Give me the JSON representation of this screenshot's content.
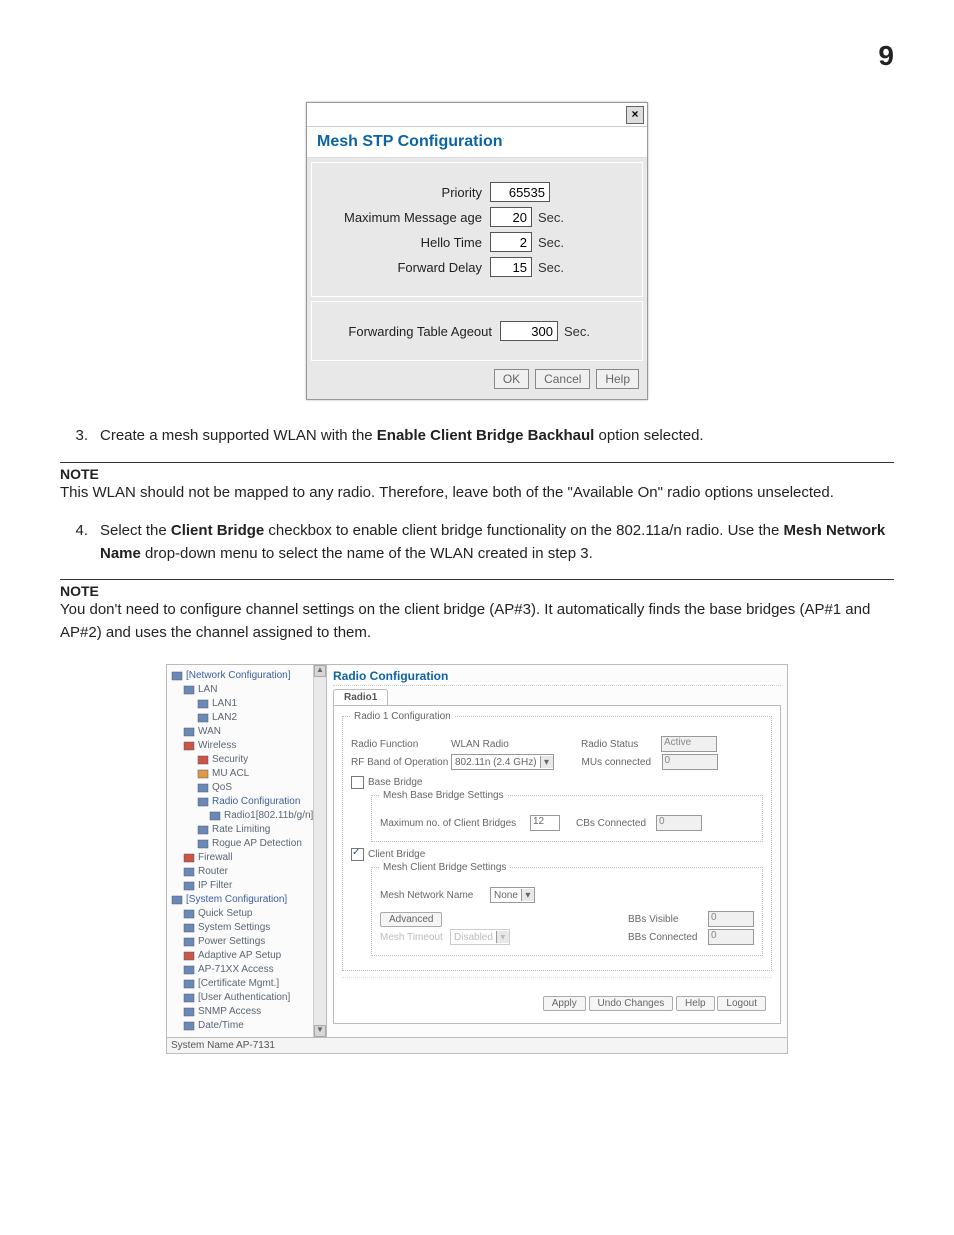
{
  "page_number": "9",
  "dialog": {
    "title": "Mesh STP Configuration",
    "close_label": "×",
    "rows": [
      {
        "label": "Priority",
        "value": "65535",
        "unit": "",
        "narrow": false
      },
      {
        "label": "Maximum Message age",
        "value": "20",
        "unit": "Sec.",
        "narrow": true
      },
      {
        "label": "Hello Time",
        "value": "2",
        "unit": "Sec.",
        "narrow": true
      },
      {
        "label": "Forward Delay",
        "value": "15",
        "unit": "Sec.",
        "narrow": true
      }
    ],
    "ageout_label": "Forwarding Table Ageout",
    "ageout_value": "300",
    "ageout_unit": "Sec.",
    "buttons": {
      "ok": "OK",
      "cancel": "Cancel",
      "help": "Help"
    }
  },
  "step3": {
    "num": "3.",
    "text_a": "Create a mesh supported WLAN with the ",
    "bold_a": "Enable Client Bridge Backhaul",
    "text_b": " option selected."
  },
  "note1": {
    "label": "NOTE",
    "text": "This WLAN should not be mapped to any radio. Therefore, leave both of the \"Available On\" radio options unselected."
  },
  "step4": {
    "num": "4.",
    "text_a": "Select the ",
    "bold_a": "Client Bridge",
    "text_b": " checkbox to enable client bridge functionality on the 802.11a/n radio. Use the ",
    "bold_b": "Mesh Network Name",
    "text_c": " drop-down menu to select the name of the WLAN created in step 3."
  },
  "note2": {
    "label": "NOTE",
    "text": "You don't need to configure channel settings on the client bridge (AP#3). It automatically finds the base bridges (AP#1 and AP#2) and uses the channel assigned to them."
  },
  "radio": {
    "tree": [
      {
        "lvl": 0,
        "text": "[Network Configuration]",
        "blue": true,
        "icon": "gear"
      },
      {
        "lvl": 1,
        "text": "LAN",
        "icon": "lan"
      },
      {
        "lvl": 2,
        "text": "LAN1",
        "icon": "node"
      },
      {
        "lvl": 2,
        "text": "LAN2",
        "icon": "node"
      },
      {
        "lvl": 1,
        "text": "WAN",
        "icon": "wan"
      },
      {
        "lvl": 1,
        "text": "Wireless",
        "icon": "wifi",
        "red": true
      },
      {
        "lvl": 2,
        "text": "Security",
        "icon": "lock",
        "red": true
      },
      {
        "lvl": 2,
        "text": "MU ACL",
        "icon": "list",
        "orange": true
      },
      {
        "lvl": 2,
        "text": "QoS",
        "icon": "qos"
      },
      {
        "lvl": 2,
        "text": "Radio Configuration",
        "icon": "antenna",
        "blue": true
      },
      {
        "lvl": 3,
        "text": "Radio1[802.11b/g/n]",
        "icon": "node"
      },
      {
        "lvl": 2,
        "text": "Rate Limiting",
        "icon": "rate"
      },
      {
        "lvl": 2,
        "text": "Rogue AP Detection",
        "icon": "rogue"
      },
      {
        "lvl": 1,
        "text": "Firewall",
        "icon": "fire",
        "red": true
      },
      {
        "lvl": 1,
        "text": "Router",
        "icon": "router"
      },
      {
        "lvl": 1,
        "text": "IP Filter",
        "icon": "node"
      },
      {
        "lvl": 0,
        "text": "[System Configuration]",
        "blue": true,
        "icon": "gear"
      },
      {
        "lvl": 1,
        "text": "Quick Setup",
        "icon": "gearb"
      },
      {
        "lvl": 1,
        "text": "System Settings",
        "icon": "gearb"
      },
      {
        "lvl": 1,
        "text": "Power Settings",
        "icon": "gearb"
      },
      {
        "lvl": 1,
        "text": "Adaptive AP Setup",
        "icon": "adapt",
        "red": true
      },
      {
        "lvl": 1,
        "text": "AP-71XX Access",
        "icon": "access"
      },
      {
        "lvl": 1,
        "text": "[Certificate Mgmt.]",
        "icon": "cert"
      },
      {
        "lvl": 1,
        "text": "[User Authentication]",
        "icon": "user"
      },
      {
        "lvl": 1,
        "text": "SNMP Access",
        "icon": "snmp"
      },
      {
        "lvl": 1,
        "text": "Date/Time",
        "icon": "clock"
      }
    ],
    "title": "Radio Configuration",
    "tab": "Radio1",
    "fieldset_main": "Radio 1 Configuration",
    "labels": {
      "radio_function": "Radio Function",
      "radio_function_val": "WLAN Radio",
      "radio_status": "Radio Status",
      "radio_status_val": "Active",
      "rf_band": "RF Band of Operation",
      "rf_band_val": "802.11n (2.4 GHz)",
      "mus_connected": "MUs connected",
      "mus_connected_val": "0",
      "base_bridge_chk": "Base Bridge",
      "fieldset_base": "Mesh Base Bridge Settings",
      "max_cb": "Maximum no. of Client Bridges",
      "max_cb_val": "12",
      "cb_conn": "CBs Connected",
      "cb_conn_val": "0",
      "client_bridge_chk": "Client Bridge",
      "fieldset_client": "Mesh Client Bridge Settings",
      "mesh_name": "Mesh Network Name",
      "mesh_name_val": "None",
      "advanced_btn": "Advanced",
      "mesh_timeout": "Mesh Timeout",
      "mesh_timeout_val": "Disabled",
      "bb_visible": "BBs Visible",
      "bb_visible_val": "0",
      "bb_conn": "BBs Connected",
      "bb_conn_val": "0"
    },
    "footer_buttons": {
      "apply": "Apply",
      "undo": "Undo Changes",
      "help": "Help",
      "logout": "Logout"
    },
    "status_bar": "System Name AP-7131"
  }
}
